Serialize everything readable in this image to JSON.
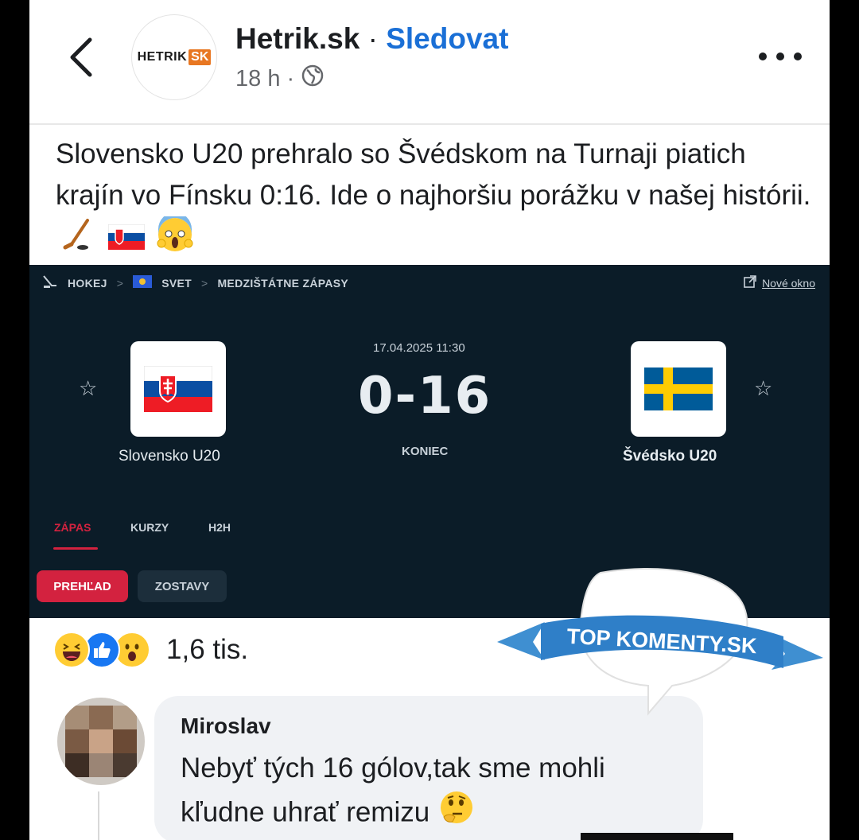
{
  "header": {
    "page_name": "Hetrik.sk",
    "separator": "·",
    "follow_label": "Sledovat",
    "time": "18 h",
    "meta_separator": "·",
    "logo_text_a": "HETRIK",
    "logo_text_b": "SK"
  },
  "post": {
    "text": "Slovensko U20 prehralo so Švédskom na Turnaji piatich krajín vo Fínsku 0:16. Ide o najhoršiu porážku v našej histórii."
  },
  "card": {
    "breadcrumb": [
      "HOKEJ",
      "SVET",
      "MEDZIŠTÁTNE ZÁPASY"
    ],
    "new_window": "Nové okno",
    "datetime": "17.04.2025 11:30",
    "score": "0-16",
    "status": "KONIEC",
    "home_team": "Slovensko U20",
    "away_team": "Švédsko U20",
    "tabs": [
      "ZÁPAS",
      "KURZY",
      "H2H"
    ],
    "subtabs": [
      "PREHĽAD",
      "ZOSTAVY"
    ],
    "colors": {
      "background": "#0b1c28",
      "accent": "#d3223f"
    }
  },
  "reactions": {
    "count": "1,6 tis.",
    "icons": [
      "laugh-icon",
      "like-icon",
      "wow-icon"
    ]
  },
  "comment": {
    "author": "Miroslav",
    "text": "Nebyť tých 16 gólov,tak sme mohli kľudne uhrať remizu"
  },
  "watermark": {
    "text": "TOP KOMENTY.SK"
  }
}
